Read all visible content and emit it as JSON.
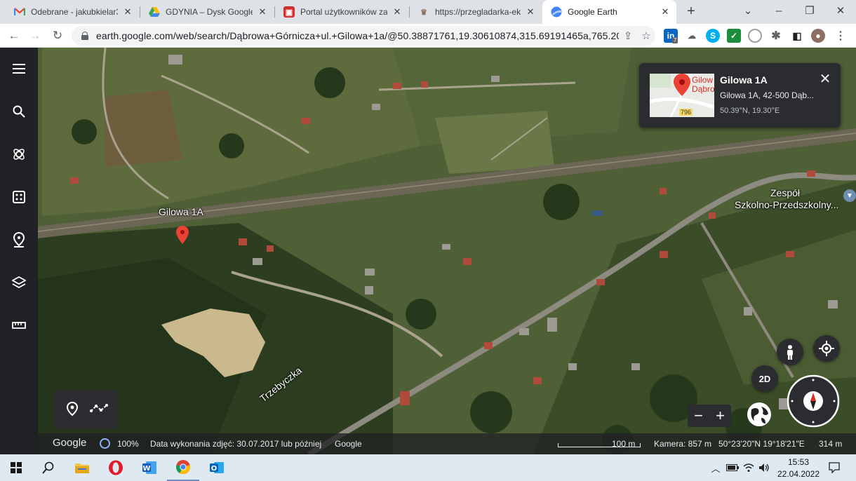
{
  "browser": {
    "tabs": [
      {
        "title": "Odebrane - jakubkielar3@",
        "favicon": "gmail-icon",
        "active": false
      },
      {
        "title": "GDYNIA – Dysk Google",
        "favicon": "google-drive-icon",
        "active": false
      },
      {
        "title": "Portal użytkowników zare",
        "favicon": "portal-icon",
        "active": false
      },
      {
        "title": "https://przegladarka-ekw",
        "favicon": "eagle-icon",
        "active": false
      },
      {
        "title": "Google Earth",
        "favicon": "google-earth-icon",
        "active": true
      }
    ],
    "url": "earth.google.com/web/search/Dąbrowa+Górnicza+ul.+Gilowa+1a/@50.38871761,19.30610874,315.69191465a,765.208303...",
    "extension_badge": "7"
  },
  "earth": {
    "labels": {
      "place": "Gilowa 1A",
      "school_line1": "Zespół",
      "school_line2": "Szkolno-Przedszkolny...",
      "street": "Trzebyczka"
    },
    "card": {
      "title": "Gilowa 1A",
      "address": "Gilowa 1A, 42-500 Dąb...",
      "coords": "50.39°N, 19.30°E",
      "thumb_line1": "Gilow",
      "thumb_line2": "Dąbro",
      "thumb_road": "796"
    },
    "view_mode": "2D",
    "status": {
      "logo": "Google",
      "loading": "100%",
      "imagery": "Data wykonania zdjęć: 30.07.2017 lub później",
      "credit": "Google",
      "scale": "100 m",
      "camera": "Kamera: 857 m",
      "coords": "50°23'20\"N 19°18'21\"E",
      "elevation": "314 m"
    }
  },
  "taskbar": {
    "time": "15:53",
    "date": "22.04.2022"
  },
  "colors": {
    "chrome_tabstrip": "#dee1e6",
    "earth_rail": "#202124",
    "pin_red": "#ea4335"
  }
}
